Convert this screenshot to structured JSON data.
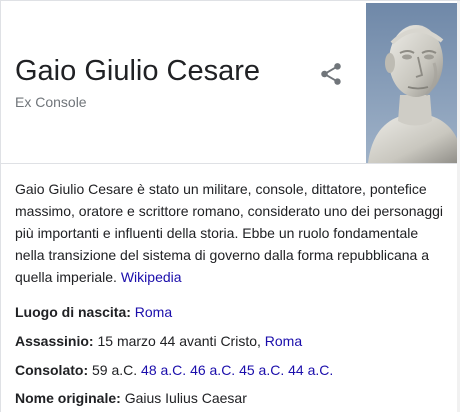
{
  "header": {
    "title": "Gaio Giulio Cesare",
    "subtitle": "Ex Console",
    "share_icon": "share-icon",
    "image_icon": "portrait-bust-image"
  },
  "description": {
    "text": "Gaio Giulio Cesare è stato un militare, console, dittatore, pontefice massimo, oratore e scrittore romano, considerato uno dei personaggi più importanti e influenti della storia. Ebbe un ruolo fondamentale nella transizione del sistema di governo dalla forma repubblicana a quella imperiale.",
    "source_link": "Wikipedia"
  },
  "facts": {
    "birth": {
      "label": "Luogo di nascita:",
      "place_link": "Roma"
    },
    "death": {
      "label": "Assassinio:",
      "text": "15 marzo 44 avanti Cristo,",
      "place_link": "Roma"
    },
    "consulate": {
      "label": "Consolato:",
      "first": "59 a.C.",
      "links": [
        "48 a.C.",
        "46 a.C.",
        "45 a.C.",
        "44 a.C."
      ]
    },
    "original_name": {
      "label": "Nome originale:",
      "value": "Gaius Iulius Caesar"
    }
  },
  "colors": {
    "link": "#1a0dab",
    "text": "#202124",
    "secondary": "#70757a",
    "divider": "#dfe1e5"
  }
}
